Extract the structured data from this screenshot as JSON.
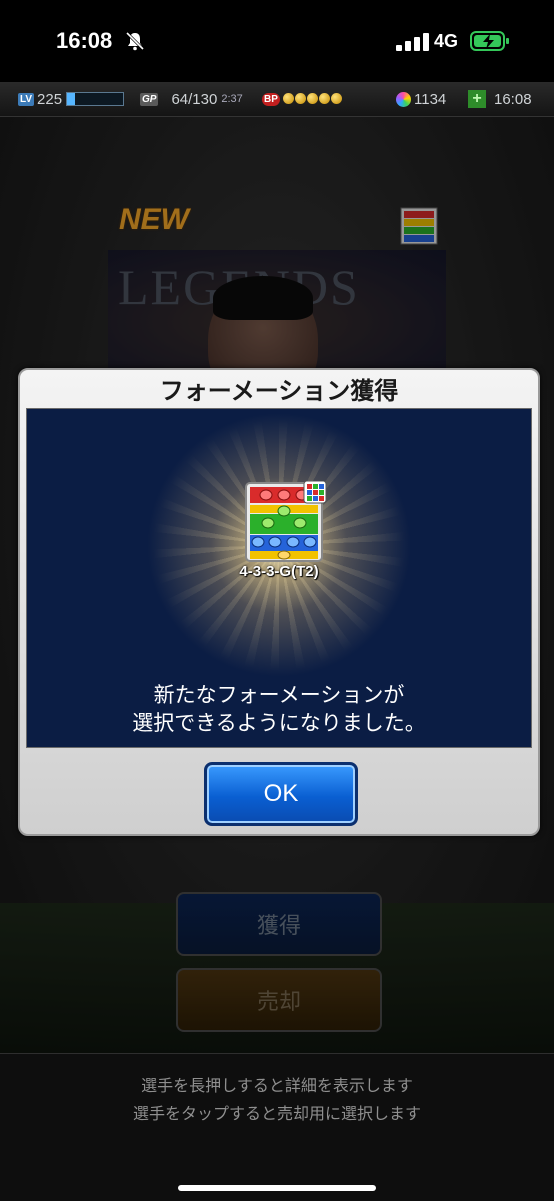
{
  "status_bar": {
    "time": "16:08",
    "network": "4G"
  },
  "hud": {
    "lv_tag": "LV",
    "level": "225",
    "level_progress": 0.15,
    "gp_tag": "GP",
    "gp": "64/130",
    "gp_timer": "2:37",
    "bp_tag": "BP",
    "bp_coins": 5,
    "gems": "1134",
    "plus": "+",
    "clock": "16:08"
  },
  "background": {
    "new_label": "NEW",
    "banner_text": "LEGENDS",
    "get_button": "獲得",
    "sell_button": "売却",
    "hint_line1": "選手を長押しすると詳細を表示します",
    "hint_line2": "選手をタップすると売却用に選択します"
  },
  "modal": {
    "title": "フォーメーション獲得",
    "formation_name": "4-3-3-G(T2)",
    "message_line1": "新たなフォーメーションが",
    "message_line2": "選択できるようになりました。",
    "ok_label": "OK"
  },
  "colors": {
    "modal_body": "#0b1d44",
    "ok_button": "#0a5fd2",
    "new_label": "#f7a92a"
  }
}
